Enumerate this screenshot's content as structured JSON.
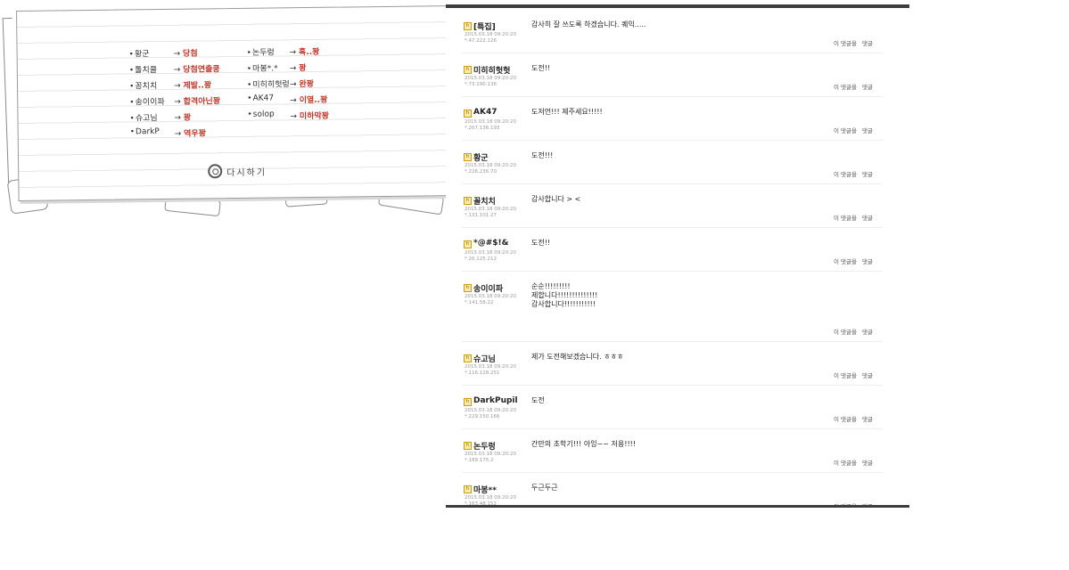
{
  "results": {
    "items": [
      {
        "name": "황군",
        "result": "당첨"
      },
      {
        "name": "톨치쿨",
        "result": "당첨연출쿵"
      },
      {
        "name": "꽁치치",
        "result": "제발..꽝"
      },
      {
        "name": "송이이파",
        "result": "합격아닌꽝"
      },
      {
        "name": "슈고님",
        "result": "꽝"
      },
      {
        "name": "DarkP",
        "result": "역우꽝"
      },
      {
        "name": "논두렁",
        "result": "혹..꽝"
      },
      {
        "name": "마봉*.*",
        "result": "꽝"
      },
      {
        "name": "미히히헛렁",
        "result": "완꽝"
      },
      {
        "name": "AK47",
        "result": "이열..꽝"
      },
      {
        "name": "solop",
        "result": "미하막꽝"
      }
    ],
    "retry_label": "다시하기"
  },
  "comments": [
    {
      "author": "[특집]",
      "date": "2015.03.18 09:20:20",
      "ip": "*.47.222.126",
      "lines": [
        "감사히 잘 쓰도록 하겠습니다. 퀘익....."
      ],
      "reply_label": "이 댓글을",
      "reply_action": "댓글"
    },
    {
      "author": "미히히헛헛",
      "date": "2015.03.18 09:20:20",
      "ip": "*.73.190.136",
      "lines": [
        "도전!!"
      ],
      "reply_label": "이 댓글을",
      "reply_action": "댓글"
    },
    {
      "author": "AK47",
      "date": "2015.03.18 09:20:20",
      "ip": "*.207.136.193",
      "lines": [
        "도저언!!! 제주세요!!!!!"
      ],
      "reply_label": "이 댓글을",
      "reply_action": "댓글"
    },
    {
      "author": "황군",
      "date": "2015.03.18 09:20:20",
      "ip": "*.226.236.70",
      "lines": [
        "도전!!!"
      ],
      "reply_label": "이 댓글을",
      "reply_action": "댓글"
    },
    {
      "author": "꼴치치",
      "date": "2015.03.18 09:20:20",
      "ip": "*.131.101.27",
      "lines": [
        "감사합니다 > <"
      ],
      "reply_label": "이 댓글을",
      "reply_action": "댓글"
    },
    {
      "author": "*@#$!&",
      "date": "2015.03.18 09:20:20",
      "ip": "*.26.125.212",
      "lines": [
        "도전!!"
      ],
      "reply_label": "이 댓글을",
      "reply_action": "댓글"
    },
    {
      "author": "송이이파",
      "date": "2015.03.18 09:20:20",
      "ip": "*.141.58.22",
      "lines": [
        "순순!!!!!!!!!",
        "제합니다!!!!!!!!!!!!!!",
        "감사합니다!!!!!!!!!!!"
      ],
      "reply_label": "이 댓글을",
      "reply_action": "댓글"
    },
    {
      "author": "슈고님",
      "date": "2015.03.18 09:20:20",
      "ip": "*.116.128.251",
      "lines": [
        "제가 도전해보겠습니다. ㅎㅎㅎ"
      ],
      "reply_label": "이 댓글을",
      "reply_action": "댓글"
    },
    {
      "author": "DarkPupil",
      "date": "2015.03.18 09:20:20",
      "ip": "*.229.150.166",
      "lines": [
        "도전"
      ],
      "reply_label": "이 댓글을",
      "reply_action": "댓글"
    },
    {
      "author": "논두렁",
      "date": "2015.03.18 09:20:20",
      "ip": "*.189.175.2",
      "lines": [
        "간만의 초학기!!! 아잉~~ 저용!!!!"
      ],
      "reply_label": "이 댓글을",
      "reply_action": "댓글"
    },
    {
      "author": "마봉**",
      "date": "2015.03.18 09:20:20",
      "ip": "*.163.48.152",
      "lines": [
        "두근두근"
      ],
      "reply_label": "이 댓글을",
      "reply_action": "댓글"
    }
  ]
}
